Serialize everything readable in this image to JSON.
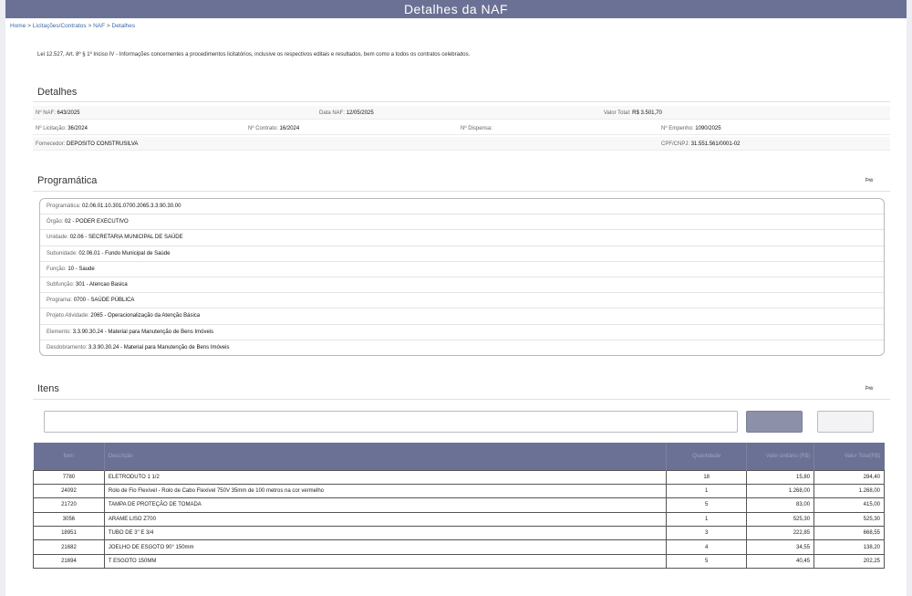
{
  "header": {
    "title": "Detalhes  da NAF"
  },
  "breadcrumb": {
    "home": "Home",
    "sep": " > ",
    "licitacoes": "Licitações/Contratos",
    "naf": "NAF",
    "detalhes": "Detalhes"
  },
  "law_text": "Lei 12.527, Art. 8º § 1º Inciso IV - Informações concernentes a procedimentos licitatórios, inclusive os respectivos editais e resultados, bem como a todos os contratos celebrados.",
  "detalhes": {
    "title": "Detalhes",
    "naf_label": "Nº NAF:",
    "naf_value": "643/2025",
    "data_label": "Data NAF:",
    "data_value": "12/05/2025",
    "valor_label": "Valor Total:",
    "valor_value": "R$ 3.501,70",
    "licitacao_label": "Nº Licitação:",
    "licitacao_value": "36/2024",
    "contrato_label": "Nº Contrato:",
    "contrato_value": "16/2024",
    "dispensa_label": "Nº Dispensa:",
    "dispensa_value": "",
    "empenho_label": "Nº Empenho:",
    "empenho_value": "1090/2025",
    "fornecedor_label": "Fornecedor:",
    "fornecedor_value": "DEPOSITO CONSTRUSILVA",
    "cnpj_label": "CPF/CNPJ:",
    "cnpj_value": "31.551.561/0001-02"
  },
  "programatica": {
    "title": "Programática",
    "pw": "Þw",
    "lines": [
      {
        "label": "Programática: ",
        "value": "02.06.01.10.301.0700.2065.3.3.90.30.00"
      },
      {
        "label": "Órgão: ",
        "value": "02 - PODER EXECUTIVO"
      },
      {
        "label": "Unidade: ",
        "value": "02.06 - SECRETARIA MUNICIPAL DE SAÚDE"
      },
      {
        "label": "Subunidade: ",
        "value": "02.06.01 - Fundo Municipal de Saúde"
      },
      {
        "label": "Função: ",
        "value": "10 - Saude"
      },
      {
        "label": "Subfunção: ",
        "value": "301 - Atencao Basica"
      },
      {
        "label": "Programa: ",
        "value": "0700 - SAÚDE PÚBLICA"
      },
      {
        "label": "Projeto Atividade: ",
        "value": "2065 - Operacionalização da Atenção Básica"
      },
      {
        "label": "Elemento: ",
        "value": "3.3.90.30.24 - Material para Manutenção de Bens Imóveis"
      },
      {
        "label": "Desdobramento: ",
        "value": "3.3.90.30.24 - Material para Manutenção de Bens Imóveis"
      }
    ]
  },
  "itens": {
    "title": "Itens",
    "pw": "Þw",
    "search": {
      "value": "",
      "placeholder": ""
    },
    "columns": {
      "code": "Item",
      "desc": "Descrição",
      "qty": "Quantidade",
      "unit": "Valor unitário (R$)",
      "total": "Valor Total(R$)"
    },
    "rows": [
      {
        "code": "7780",
        "desc": "ELETRODUTO 1 1/2",
        "qty": "18",
        "unit": "15,80",
        "total": "284,40"
      },
      {
        "code": "24092",
        "desc": "Rolo de Fio Flexível - Rolo de Cabo Flexível 750V 35mm de 100 metros na cor vermelho",
        "qty": "1",
        "unit": "1.268,00",
        "total": "1.268,00"
      },
      {
        "code": "21720",
        "desc": "TAMPA DE PROTEÇÃO DE TOMADA",
        "qty": "5",
        "unit": "83,00",
        "total": "415,00"
      },
      {
        "code": "3056",
        "desc": "ARAME LISO Z700",
        "qty": "1",
        "unit": "525,30",
        "total": "525,30"
      },
      {
        "code": "18951",
        "desc": "TUBO DE 3\" E 3/4",
        "qty": "3",
        "unit": "222,85",
        "total": "668,55"
      },
      {
        "code": "21682",
        "desc": "JOELHO DE ESGOTO 90° 150mm",
        "qty": "4",
        "unit": "34,55",
        "total": "138,20"
      },
      {
        "code": "21694",
        "desc": "T ESGOTO 150MM",
        "qty": "5",
        "unit": "40,45",
        "total": "202,25"
      }
    ]
  }
}
